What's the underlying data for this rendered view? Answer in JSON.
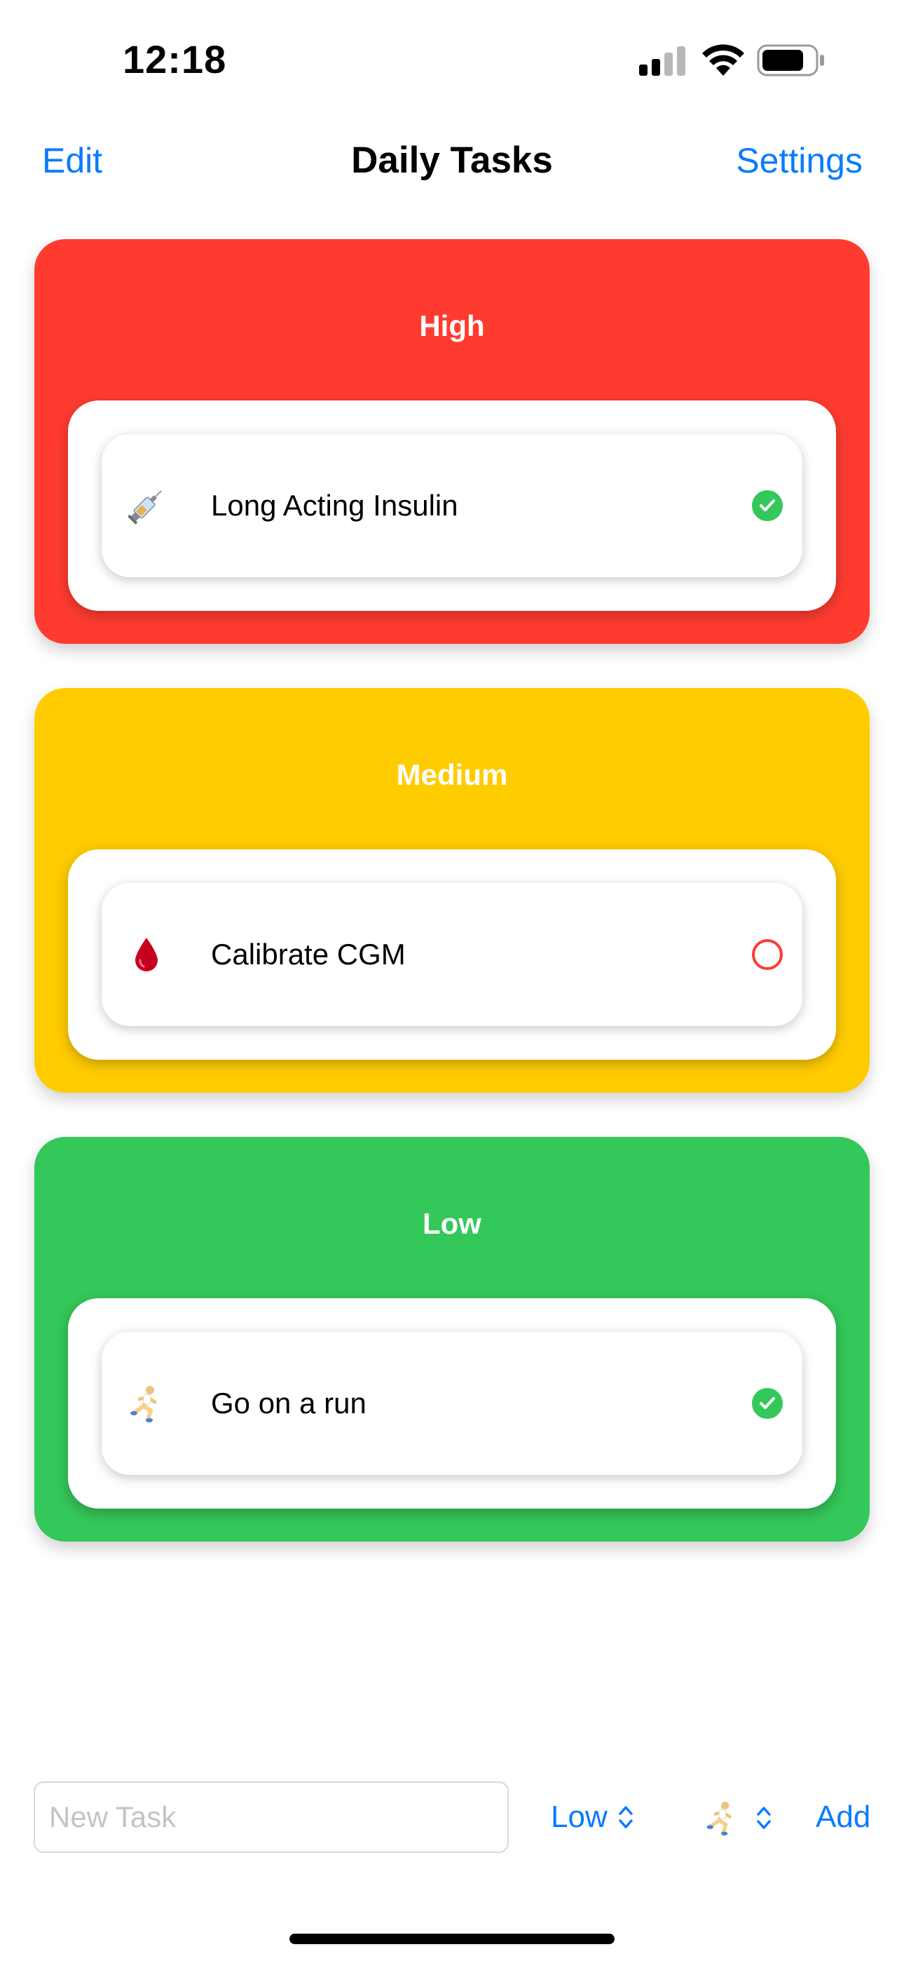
{
  "status_bar": {
    "time": "12:18",
    "icons": [
      "cellular-signal-icon",
      "wifi-icon",
      "battery-icon"
    ]
  },
  "nav": {
    "left_button": "Edit",
    "title": "Daily Tasks",
    "right_button": "Settings"
  },
  "sections": [
    {
      "title": "High",
      "color": "#ff3b30",
      "tasks": [
        {
          "icon": "syringe-icon",
          "label": "Long Acting Insulin",
          "completed": true
        }
      ]
    },
    {
      "title": "Medium",
      "color": "#ffcc00",
      "tasks": [
        {
          "icon": "blood-drop-icon",
          "label": "Calibrate CGM",
          "completed": false
        }
      ]
    },
    {
      "title": "Low",
      "color": "#34c759",
      "tasks": [
        {
          "icon": "runner-icon",
          "label": "Go on a run",
          "completed": true
        }
      ]
    }
  ],
  "bottom_bar": {
    "new_task_placeholder": "New Task",
    "new_task_value": "",
    "priority_value": "Low",
    "icon_value": "runner-icon",
    "add_label": "Add"
  },
  "colors": {
    "accent": "#0a7bff",
    "completed": "#34c759",
    "incomplete": "#ff3b30"
  }
}
